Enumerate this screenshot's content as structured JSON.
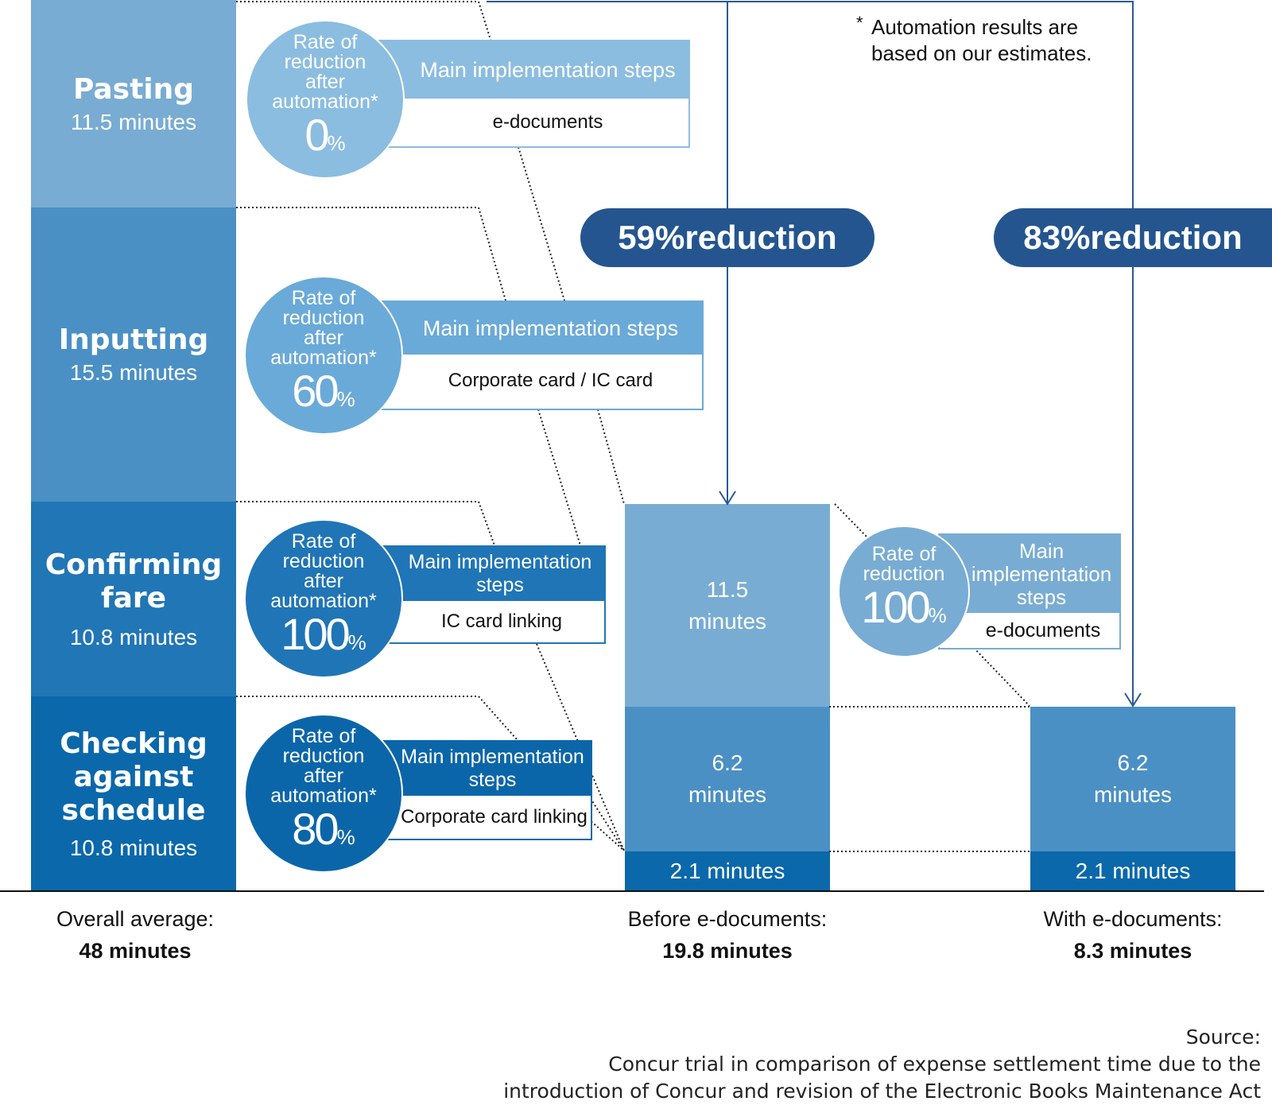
{
  "colors": {
    "pasting": "#78acd3",
    "inputting": "#4a90c4",
    "confirming": "#2176b5",
    "checking": "#0a68ab",
    "badge": "#24558f"
  },
  "note": {
    "star": "*",
    "text1": "Automation results are",
    "text2": "based on our estimates."
  },
  "tasks": [
    {
      "title": "Pasting",
      "minutes": "11.5 minutes",
      "rate_label": [
        "Rate of",
        "reduction",
        "after",
        "automation*"
      ],
      "rate": "0",
      "unit": "%",
      "steps_header": "Main implementation steps",
      "step": "e-documents"
    },
    {
      "title": "Inputting",
      "minutes": "15.5 minutes",
      "rate_label": [
        "Rate of",
        "reduction",
        "after",
        "automation*"
      ],
      "rate": "60",
      "unit": "%",
      "steps_header": "Main implementation steps",
      "step": "Corporate card / IC card"
    },
    {
      "title": "Confirming fare",
      "minutes": "10.8 minutes",
      "rate_label": [
        "Rate of",
        "reduction",
        "after",
        "automation*"
      ],
      "rate": "100",
      "unit": "%",
      "steps_header": "Main implementation steps",
      "step": "IC card linking"
    },
    {
      "title": "Checking against schedule",
      "minutes": "10.8 minutes",
      "rate_label": [
        "Rate of",
        "reduction",
        "after",
        "automation*"
      ],
      "rate": "80",
      "unit": "%",
      "steps_header": "Main implementation steps",
      "step": "Corporate card linking"
    }
  ],
  "before": {
    "segments": [
      "11.5 minutes",
      "6.2 minutes",
      "2.1 minutes"
    ],
    "badge": "59%reduction",
    "label": "Before e-documents:",
    "total": "19.8 minutes"
  },
  "after": {
    "segments": [
      "6.2 minutes",
      "2.1 minutes"
    ],
    "badge": "83%reduction",
    "label": "With e-documents:",
    "total": "8.3 minutes",
    "rate_label": [
      "Rate of",
      "reduction"
    ],
    "rate": "100",
    "unit": "%",
    "steps_header": "Main implementation steps",
    "step": "e-documents"
  },
  "overall": {
    "label": "Overall average:",
    "total": "48 minutes"
  },
  "source": {
    "label": "Source:",
    "line1": "Concur trial in comparison of expense settlement time due to the",
    "line2": "introduction of Concur and revision of the Electronic Books Maintenance Act"
  }
}
